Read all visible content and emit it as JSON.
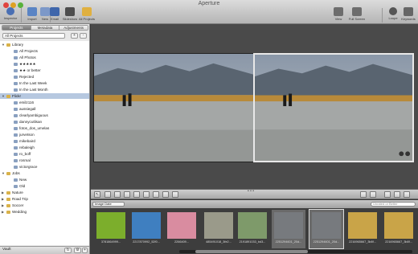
{
  "window": {
    "title": "Aperture"
  },
  "toolbar": {
    "inspector": "Inspector",
    "import": "Import",
    "new": "New",
    "email": "Email",
    "slideshow": "Slideshow",
    "all_projects": "All Projects",
    "view": "View",
    "full_screen": "Full Screen",
    "loupe": "Loupe",
    "keywords": "Keywords"
  },
  "sidebar": {
    "tabs": [
      "Projects",
      "Metadata",
      "Adjustments"
    ],
    "project_select": "All Projects",
    "items": [
      {
        "label": "Library",
        "level": 0,
        "expanded": true
      },
      {
        "label": "All Projects",
        "level": 1
      },
      {
        "label": "All Photos",
        "level": 1
      },
      {
        "label": "★★★★★",
        "level": 1
      },
      {
        "label": "★★ or better",
        "level": 1
      },
      {
        "label": "Rejected",
        "level": 1
      },
      {
        "label": "In the Last Week",
        "level": 1
      },
      {
        "label": "In the Last Month",
        "level": 1
      },
      {
        "label": "Flickr",
        "level": 0,
        "expanded": true,
        "selected": true
      },
      {
        "label": "emilz116",
        "level": 1
      },
      {
        "label": "aussiegall",
        "level": 1
      },
      {
        "label": "clearlyambiguous",
        "level": 1
      },
      {
        "label": "dannycutlisan",
        "level": 1
      },
      {
        "label": "fotos_dos_umelas",
        "level": 1
      },
      {
        "label": "jurvetson",
        "level": 1
      },
      {
        "label": "mikebaird",
        "level": 1
      },
      {
        "label": "rebaleigh",
        "level": 1
      },
      {
        "label": "ro_boff",
        "level": 1
      },
      {
        "label": "rosmal",
        "level": 1
      },
      {
        "label": "victorgrace",
        "level": 1
      },
      {
        "label": "Jobs",
        "level": 0,
        "expanded": true
      },
      {
        "label": "New",
        "level": 1
      },
      {
        "label": "Old",
        "level": 1
      },
      {
        "label": "Nature",
        "level": 0
      },
      {
        "label": "Road Trip",
        "level": 0
      },
      {
        "label": "Soccer",
        "level": 0
      },
      {
        "label": "Wedding",
        "level": 0
      }
    ],
    "bottom_label": "Vault"
  },
  "browser": {
    "sort": "Image Date",
    "search_placeholder": "Unrated or Better",
    "thumbnails": [
      {
        "caption": "3781864999...",
        "color": "#7cae2c"
      },
      {
        "caption": "2217870992_52f0...",
        "color": "#3f7fc0"
      },
      {
        "caption": "2266409...",
        "color": "#d98ca0"
      },
      {
        "caption": "485491018_3fe2...",
        "color": "#9a9a8a"
      },
      {
        "caption": "2191891033_bd3...",
        "color": "#7e9a6a"
      },
      {
        "caption": "2251294601_20d...",
        "color": "#777a7e"
      },
      {
        "caption": "2251294601_20d...",
        "color": "#777a7e"
      },
      {
        "caption": "2216965667_3b8f...",
        "color": "#c9a448"
      },
      {
        "caption": "2216965667_3b8f...",
        "color": "#c9a448"
      }
    ]
  }
}
